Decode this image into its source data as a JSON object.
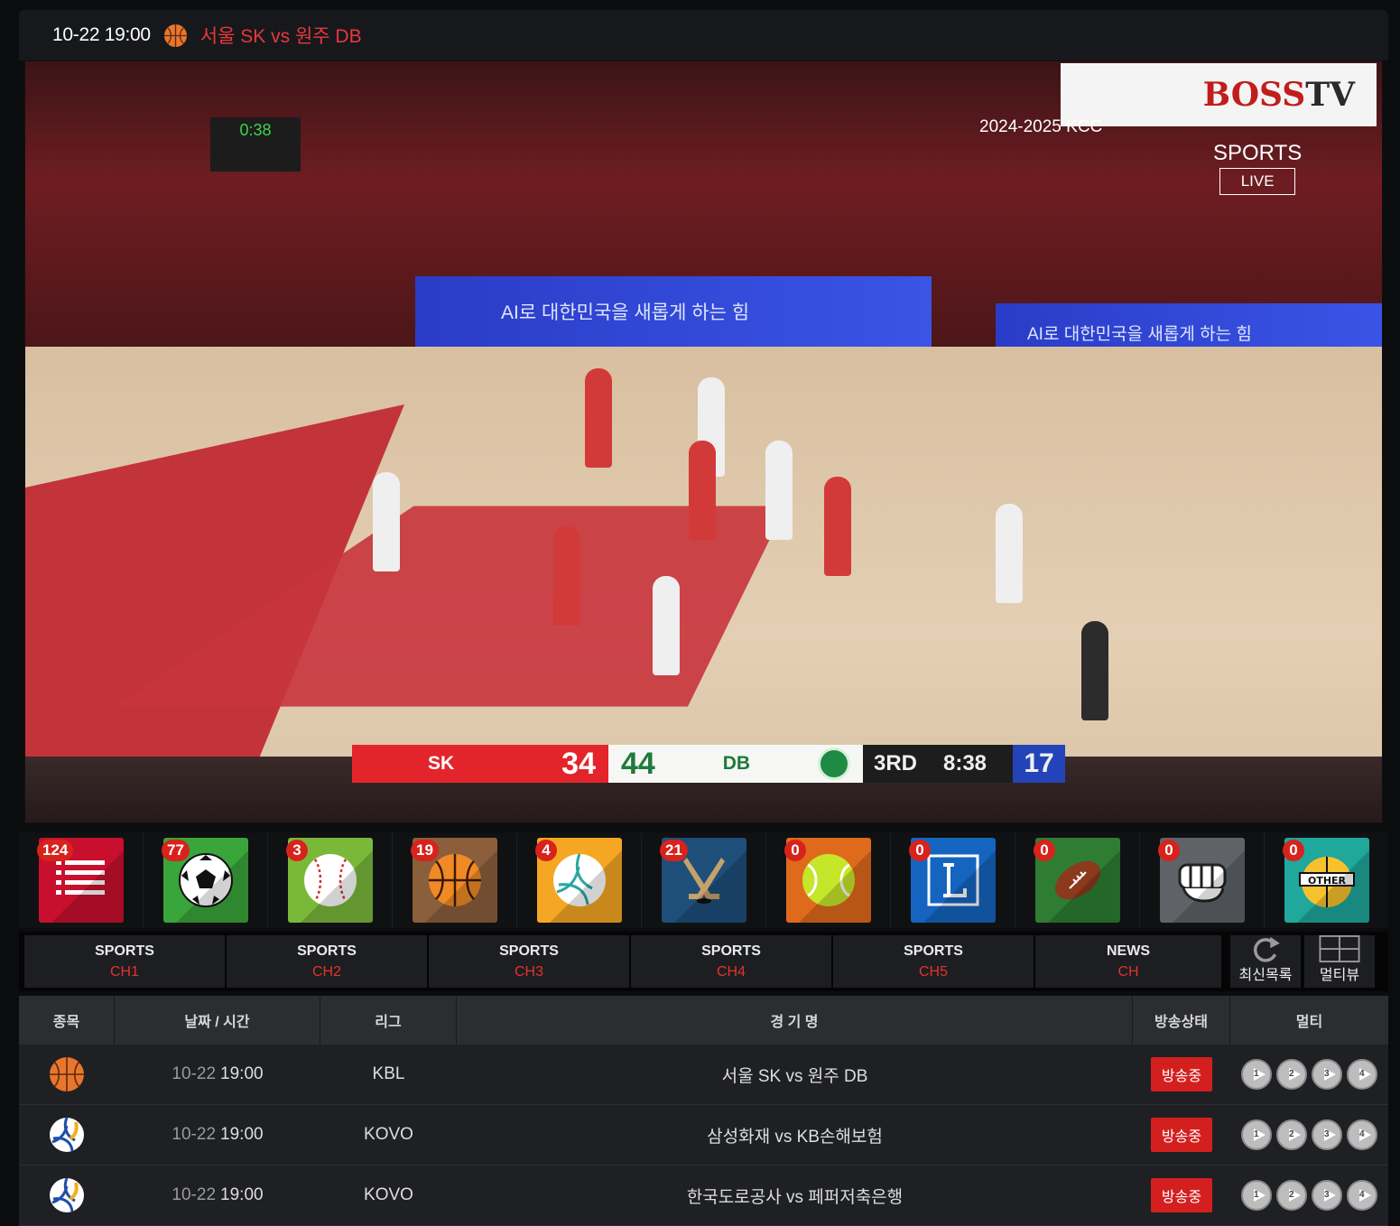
{
  "header": {
    "time": "10-22 19:00",
    "sport_icon": "basketball-icon",
    "match": "서울 SK vs 원주 DB"
  },
  "video": {
    "watermark_brand": "BOSS",
    "watermark_tv": "TV",
    "overlay_season": "2024-2025 KCC",
    "overlay_sports": "SPORTS",
    "overlay_live": "LIVE",
    "banner_text": "AI로 대한민국을 새롭게 하는 힘",
    "shot_clock_display": "0:38",
    "scoreboard": {
      "home_team": "SK",
      "home_score": "34",
      "away_score": "44",
      "away_team": "DB",
      "quarter": "3RD",
      "clock": "8:38",
      "shot_clock": "17"
    }
  },
  "categories": [
    {
      "icon": "list-icon",
      "count": "124",
      "color": "#c8102e"
    },
    {
      "icon": "soccer-ball-icon",
      "count": "77",
      "color": "#3aa53a"
    },
    {
      "icon": "baseball-icon",
      "count": "3",
      "color": "#7ab83a"
    },
    {
      "icon": "basketball-icon",
      "count": "19",
      "color": "#8b5e3c"
    },
    {
      "icon": "volleyball-icon",
      "count": "4",
      "color": "#f5a623"
    },
    {
      "icon": "hockey-icon",
      "count": "21",
      "color": "#1e4f7a"
    },
    {
      "icon": "tennis-ball-icon",
      "count": "0",
      "color": "#e06a1b"
    },
    {
      "icon": "league-l-icon",
      "count": "0",
      "color": "#1565c0"
    },
    {
      "icon": "american-football-icon",
      "count": "0",
      "color": "#2e7d32"
    },
    {
      "icon": "fist-icon",
      "count": "0",
      "color": "#5f6368"
    },
    {
      "icon": "other-icon",
      "count": "0",
      "color": "#1fa89b"
    }
  ],
  "channels": [
    {
      "title": "SPORTS",
      "sub": "CH1"
    },
    {
      "title": "SPORTS",
      "sub": "CH2"
    },
    {
      "title": "SPORTS",
      "sub": "CH3"
    },
    {
      "title": "SPORTS",
      "sub": "CH4"
    },
    {
      "title": "SPORTS",
      "sub": "CH5"
    },
    {
      "title": "NEWS",
      "sub": "CH"
    }
  ],
  "tools": {
    "refresh_label": "최신목록",
    "multiview_label": "멀티뷰"
  },
  "table": {
    "headers": [
      "종목",
      "날짜 / 시간",
      "리그",
      "경 기 명",
      "방송상태",
      "멀티"
    ],
    "rows": [
      {
        "sport_icon": "basketball-icon",
        "date": "10-22",
        "time": "19:00",
        "league": "KBL",
        "match": "서울 SK vs 원주 DB",
        "status": "방송중"
      },
      {
        "sport_icon": "volleyball-icon",
        "date": "10-22",
        "time": "19:00",
        "league": "KOVO",
        "match": "삼성화재 vs KB손해보험",
        "status": "방송중"
      },
      {
        "sport_icon": "volleyball-icon",
        "date": "10-22",
        "time": "19:00",
        "league": "KOVO",
        "match": "한국도로공사 vs 페퍼저축은행",
        "status": "방송중"
      }
    ],
    "multi_buttons": [
      "1",
      "2",
      "3",
      "4"
    ]
  }
}
